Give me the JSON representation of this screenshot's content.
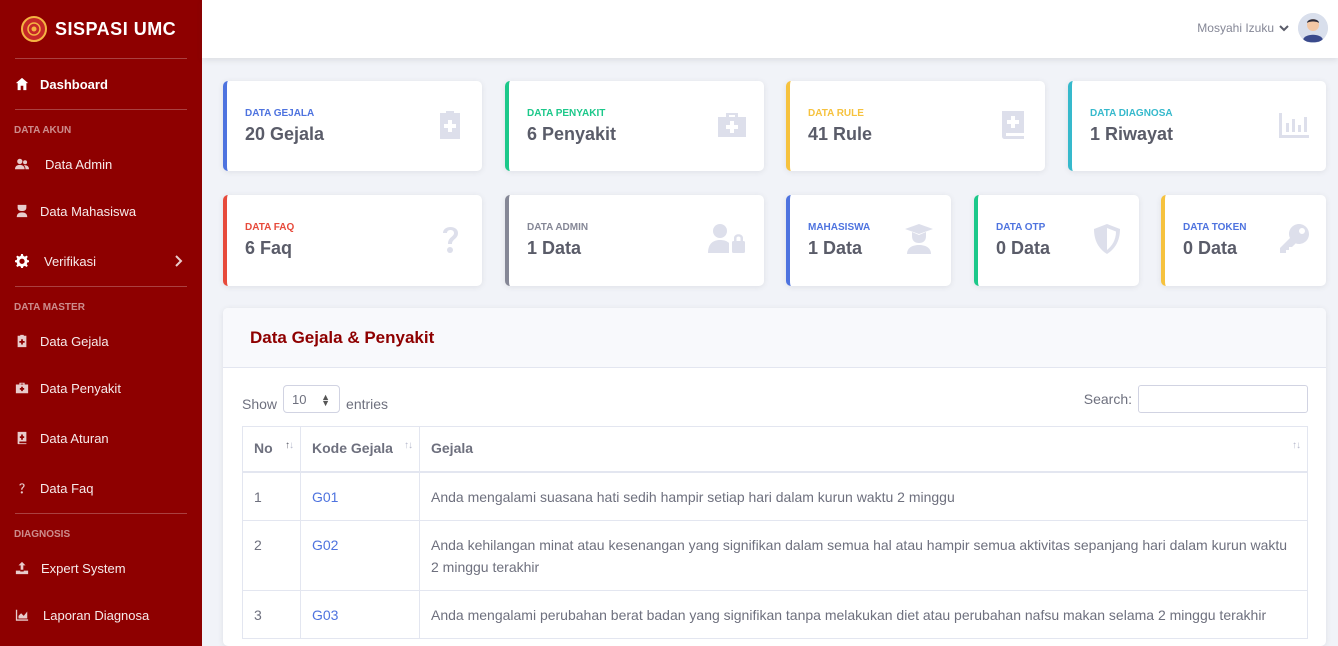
{
  "brand": {
    "name": "SISPASI UMC"
  },
  "sidebar": {
    "dashboard": "Dashboard",
    "heading_akun": "DATA AKUN",
    "data_admin": "Data Admin",
    "data_mahasiswa": "Data Mahasiswa",
    "verifikasi": "Verifikasi",
    "heading_master": "DATA MASTER",
    "data_gejala": "Data Gejala",
    "data_penyakit": "Data Penyakit",
    "data_aturan": "Data Aturan",
    "data_faq": "Data Faq",
    "heading_diagnosis": "DIAGNOSIS",
    "expert_system": "Expert System",
    "laporan_diagnosa": "Laporan Diagnosa"
  },
  "topbar": {
    "user_name": "Mosyahi Izuku"
  },
  "cards": {
    "gejala": {
      "label": "DATA GEJALA",
      "value": "20 Gejala",
      "color": "#4e73df"
    },
    "penyakit": {
      "label": "DATA PENYAKIT",
      "value": "6 Penyakit",
      "color": "#1cc88a"
    },
    "rule": {
      "label": "DATA RULE",
      "value": "41 Rule",
      "color": "#f6c23e"
    },
    "diagnosa": {
      "label": "DATA DIAGNOSA",
      "value": "1 Riwayat",
      "color": "#36b9cc"
    },
    "faq": {
      "label": "DATA FAQ",
      "value": "6 Faq",
      "color": "#e74a3b"
    },
    "admin": {
      "label": "DATA ADMIN",
      "value": "1 Data",
      "color": "#858796"
    },
    "mahasiswa": {
      "label": "MAHASISWA",
      "value": "1 Data",
      "color": "#4e73df"
    },
    "otp": {
      "label": "DATA OTP",
      "value": "0 Data",
      "color": "#1cc88a"
    },
    "token": {
      "label": "DATA TOKEN",
      "value": "0 Data",
      "color": "#f6c23e"
    }
  },
  "panel": {
    "title": "Data Gejala & Penyakit",
    "show_label": "Show",
    "entries_value": "10",
    "entries_label": "entries",
    "search_label": "Search:",
    "search_value": ""
  },
  "table": {
    "headers": [
      "No",
      "Kode Gejala",
      "Gejala"
    ],
    "rows": [
      {
        "no": "1",
        "kode": "G01",
        "gejala": "Anda mengalami suasana hati sedih hampir setiap hari dalam kurun waktu 2 minggu"
      },
      {
        "no": "2",
        "kode": "G02",
        "gejala": "Anda kehilangan minat atau kesenangan yang signifikan dalam semua hal atau hampir semua aktivitas sepanjang hari dalam kurun waktu 2 minggu terakhir"
      },
      {
        "no": "3",
        "kode": "G03",
        "gejala": "Anda mengalami perubahan berat badan yang signifikan tanpa melakukan diet atau perubahan nafsu makan selama 2 minggu terakhir"
      }
    ]
  }
}
